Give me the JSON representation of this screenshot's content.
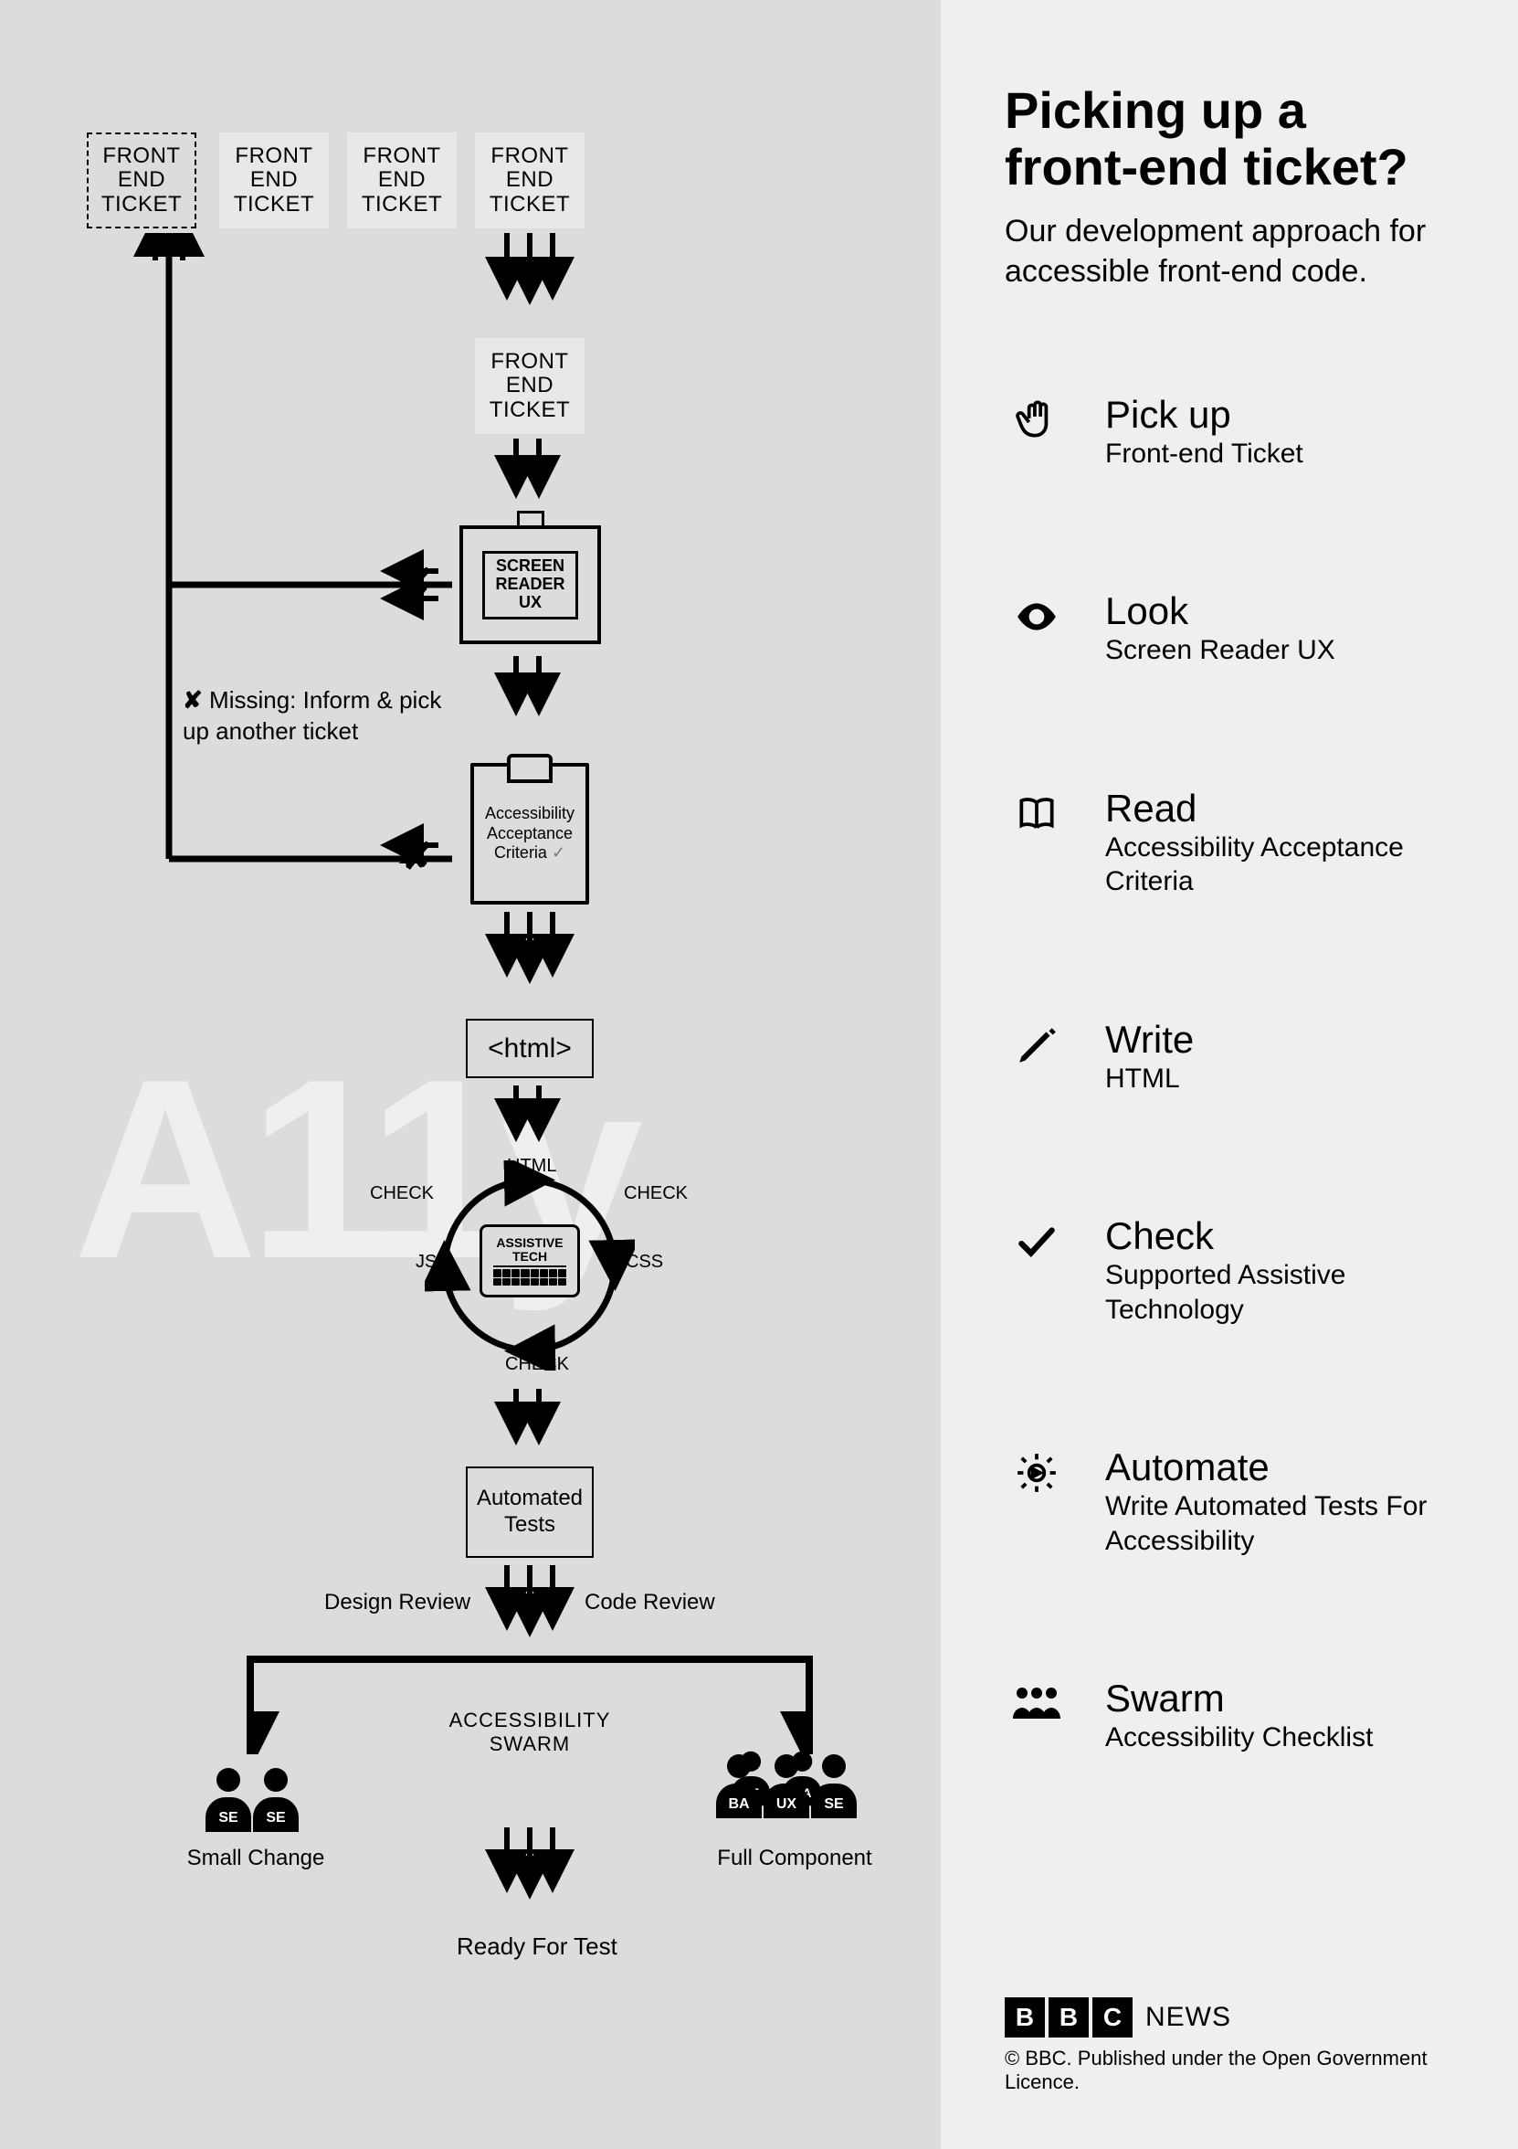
{
  "right": {
    "title_line1": "Picking up a",
    "title_line2": "front-end ticket?",
    "subtitle": "Our development approach for accessible front-end code.",
    "steps": [
      {
        "title": "Pick up",
        "desc": "Front-end Ticket",
        "icon": "hand"
      },
      {
        "title": "Look",
        "desc": "Screen Reader UX",
        "icon": "eye"
      },
      {
        "title": "Read",
        "desc": "Accessibility Acceptance Criteria",
        "icon": "book"
      },
      {
        "title": "Write",
        "desc": "HTML",
        "icon": "pencil"
      },
      {
        "title": "Check",
        "desc": "Supported Assistive Technology",
        "icon": "check"
      },
      {
        "title": "Automate",
        "desc": "Write Automated Tests For Accessibility",
        "icon": "gear"
      },
      {
        "title": "Swarm",
        "desc": "Accessibility Checklist",
        "icon": "people"
      }
    ],
    "footer": {
      "bbc_letters": [
        "B",
        "B",
        "C"
      ],
      "news": "NEWS",
      "copyright": "© BBC. Published under the Open Government Licence."
    }
  },
  "left": {
    "watermark": "A11y",
    "tickets": {
      "label_l1": "FRONT",
      "label_l2": "END",
      "label_l3": "TICKET"
    },
    "note_x": "✘",
    "note_text": "Missing: Inform & pick up another ticket",
    "screen_reader": {
      "l1": "SCREEN",
      "l2": "READER",
      "l3": "UX"
    },
    "acceptance": {
      "l1": "Accessibility",
      "l2": "Acceptance",
      "l3": "Criteria"
    },
    "checkmark": "✓",
    "html": "<html>",
    "cycle": {
      "top": "HTML",
      "right": "CSS",
      "bottom": "CHECK",
      "left": "JS",
      "sidel": "CHECK",
      "sider": "CHECK",
      "box_l1": "ASSISTIVE",
      "box_l2": "TECH"
    },
    "auto_l1": "Automated",
    "auto_l2": "Tests",
    "design_review": "Design Review",
    "code_review": "Code Review",
    "swarm_l1": "ACCESSIBILITY",
    "swarm_l2": "SWARM",
    "small_change": "Small Change",
    "full_component": "Full Component",
    "ready": "Ready For Test",
    "roles": {
      "se": "SE",
      "ba": "BA",
      "ux": "UX",
      "qa": "QA"
    }
  }
}
